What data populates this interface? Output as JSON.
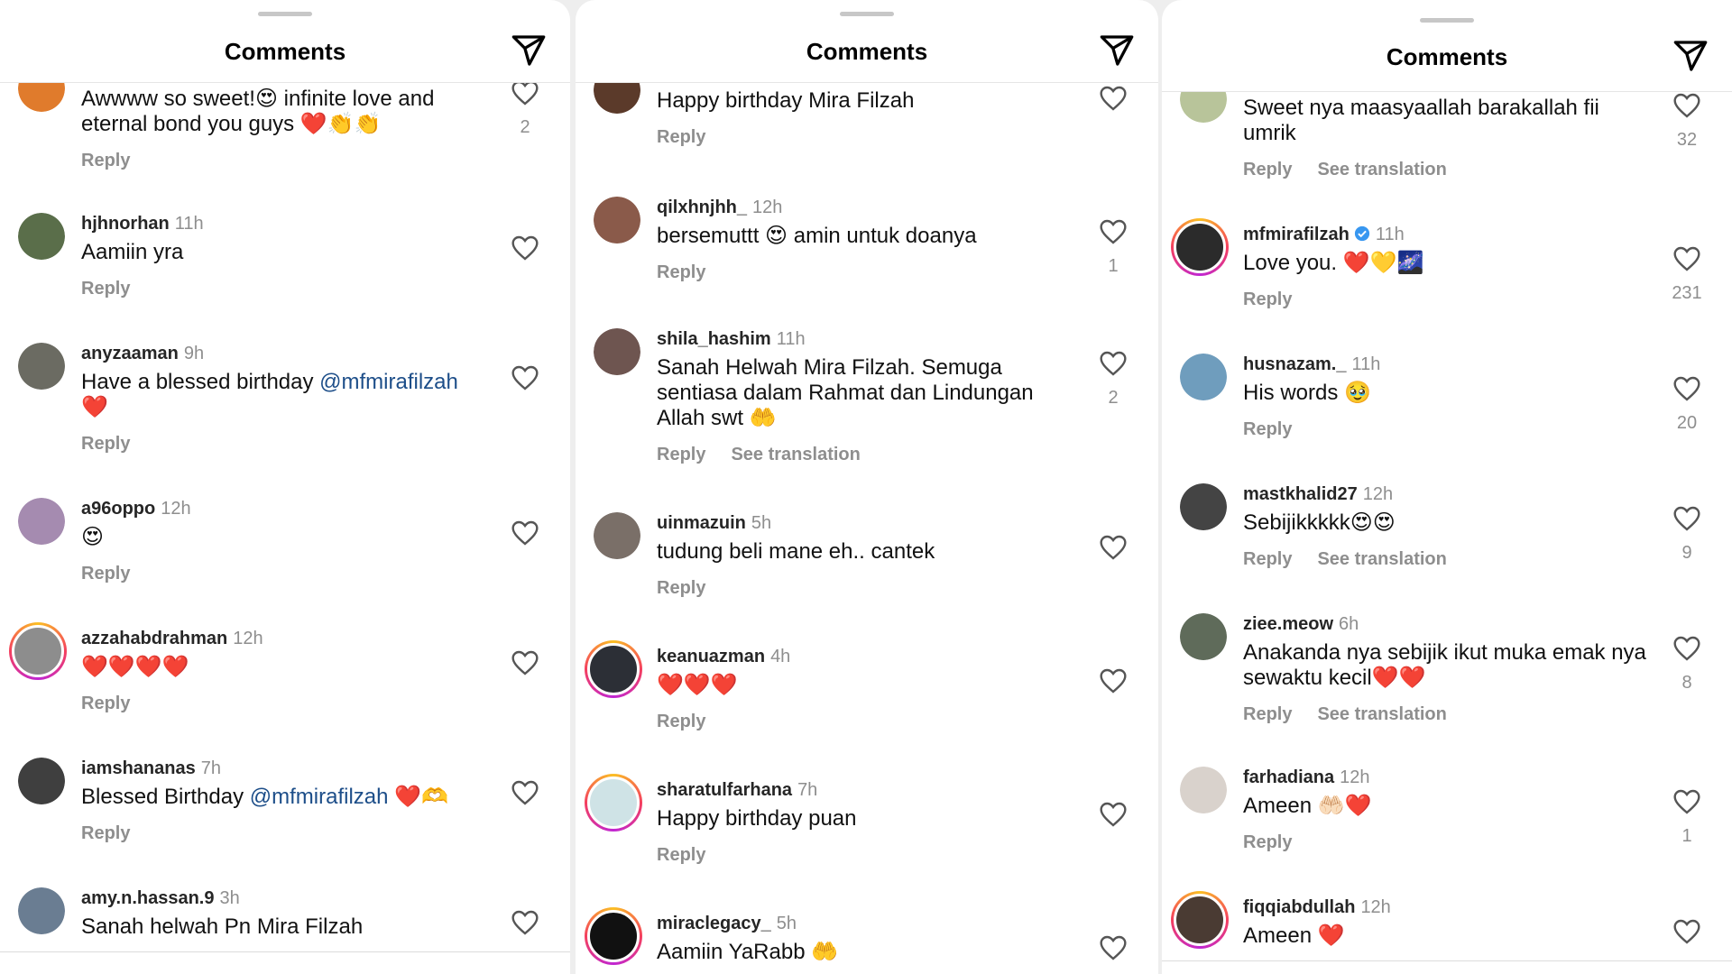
{
  "colors": {
    "mention": "#1d4e89",
    "muted": "#8e8e8e",
    "heart_red": "#e41e3f",
    "verified_blue": "#3897f0"
  },
  "panels": [
    {
      "title": "Comments",
      "header_icon": "send-icon",
      "comments": [
        {
          "user": "",
          "time": "",
          "text": "Awwww so sweet!😍 infinite love and eternal bond you guys ❤️👏👏",
          "reply": "Reply",
          "translate": "",
          "likes": "2",
          "avatar_color": "#e07b2c"
        },
        {
          "user": "hjhnorhan",
          "time": "11h",
          "text": "Aamiin yra",
          "reply": "Reply",
          "translate": "",
          "likes": "",
          "avatar_color": "#5a6e4a"
        },
        {
          "user": "anyzaaman",
          "time": "9h",
          "text": "Have a blessed birthday",
          "mention": "@mfmirafilzah",
          "text_after": "❤️",
          "reply": "Reply",
          "translate": "",
          "likes": "",
          "avatar_color": "#6b6b62"
        },
        {
          "user": "a96oppo",
          "time": "12h",
          "text": "😍",
          "reply": "Reply",
          "translate": "",
          "likes": "",
          "avatar_color": "#a58bb0"
        },
        {
          "user": "azzahabdrahman",
          "time": "12h",
          "text": "❤️❤️❤️❤️",
          "reply": "Reply",
          "translate": "",
          "likes": "",
          "avatar_color": "#8d8d8d"
        },
        {
          "user": "iamshananas",
          "time": "7h",
          "text": "Blessed Birthday",
          "mention": "@mfmirafilzah",
          "text_after": "❤️🫶",
          "reply": "Reply",
          "translate": "",
          "likes": "",
          "avatar_color": "#3f3f3f"
        },
        {
          "user": "amy.n.hassan.9",
          "time": "3h",
          "text": "Sanah helwah Pn Mira Filzah",
          "reply": "",
          "translate": "",
          "likes": "",
          "avatar_color": "#6a7d92"
        }
      ]
    },
    {
      "title": "Comments",
      "header_icon": "send-icon",
      "comments": [
        {
          "user": "",
          "time": "",
          "text": "Happy birthday Mira Filzah",
          "reply": "Reply",
          "translate": "",
          "likes": "",
          "avatar_color": "#5b3a2a"
        },
        {
          "user": "qilxhnjhh_",
          "time": "12h",
          "text": "bersemuttt 😍 amin untuk doanya",
          "reply": "Reply",
          "translate": "",
          "likes": "1",
          "avatar_color": "#8a5a4a"
        },
        {
          "user": "shila_hashim",
          "time": "11h",
          "text": "Sanah Helwah Mira Filzah. Semuga sentiasa dalam Rahmat dan Lindungan Allah swt 🤲",
          "reply": "Reply",
          "translate": "See translation",
          "likes": "2",
          "avatar_color": "#6e5550"
        },
        {
          "user": "uinmazuin",
          "time": "5h",
          "text": "tudung beli mane eh.. cantek",
          "reply": "Reply",
          "translate": "",
          "likes": "",
          "avatar_color": "#7a6f68"
        },
        {
          "user": "keanuazman",
          "time": "4h",
          "text": "❤️❤️❤️",
          "reply": "Reply",
          "translate": "",
          "likes": "",
          "avatar_color": "#2c2f36"
        },
        {
          "user": "sharatulfarhana",
          "time": "7h",
          "text": "Happy birthday puan",
          "reply": "Reply",
          "translate": "",
          "likes": "",
          "avatar_color": "#cfe3e6"
        },
        {
          "user": "miraclegacy_",
          "time": "5h",
          "text": "Aamiin YaRabb 🤲",
          "reply": "",
          "translate": "",
          "likes": "",
          "avatar_color": "#111111"
        }
      ]
    },
    {
      "title": "Comments",
      "header_icon": "send-icon",
      "comments": [
        {
          "user": "",
          "time": "",
          "text": "Sweet nya maasyaallah  barakallah fii umrik",
          "reply": "Reply",
          "translate": "See translation",
          "likes": "32",
          "avatar_color": "#b8c49a"
        },
        {
          "user": "mfmirafilzah",
          "verified": true,
          "time": "11h",
          "text": "Love you. ❤️💛🌌",
          "reply": "Reply",
          "translate": "",
          "likes": "231",
          "avatar_color": "#2b2b2b"
        },
        {
          "user": "husnazam._",
          "time": "11h",
          "text": "His words 🥹",
          "reply": "Reply",
          "translate": "",
          "likes": "20",
          "avatar_color": "#6f9dbd"
        },
        {
          "user": "mastkhalid27",
          "time": "12h",
          "text": "Sebijikkkkk😍😍",
          "reply": "Reply",
          "translate": "See translation",
          "likes": "9",
          "avatar_color": "#444444"
        },
        {
          "user": "ziee.meow",
          "time": "6h",
          "text": "Anakanda nya sebijik ikut muka emak nya sewaktu kecil❤️❤️",
          "reply": "Reply",
          "translate": "See translation",
          "likes": "8",
          "avatar_color": "#5f6b5a"
        },
        {
          "user": "farhadiana",
          "time": "12h",
          "text": "Ameen 🤲🏻❤️",
          "reply": "Reply",
          "translate": "",
          "likes": "1",
          "avatar_color": "#d9d2cc"
        },
        {
          "user": "fiqqiabdullah",
          "time": "12h",
          "text": "Ameen ❤️",
          "reply": "",
          "translate": "",
          "likes": "",
          "avatar_color": "#4a3b33"
        }
      ]
    }
  ]
}
